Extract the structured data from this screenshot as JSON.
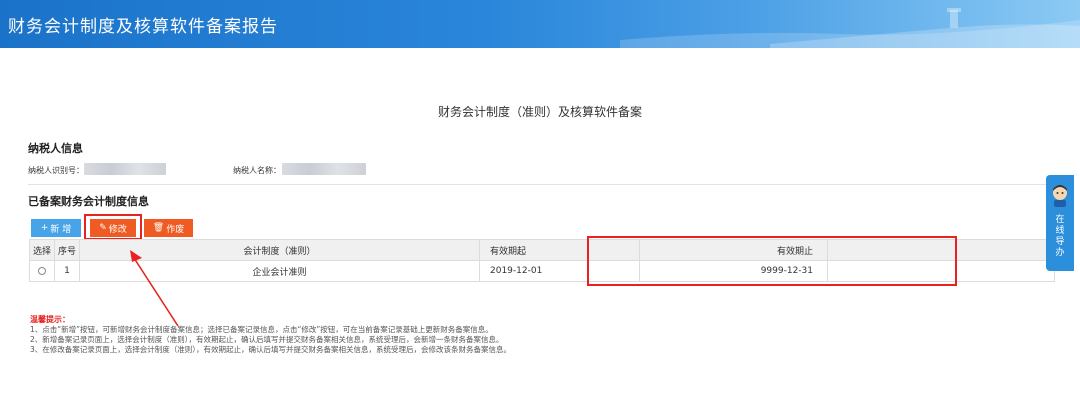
{
  "header": {
    "title": "财务会计制度及核算软件备案报告"
  },
  "page": {
    "title": "财务会计制度（准则）及核算软件备案"
  },
  "taxpayer": {
    "section_title": "纳税人信息",
    "id_label": "纳税人识别号：",
    "name_label": "纳税人名称："
  },
  "filed": {
    "section_title": "已备案财务会计制度信息",
    "buttons": {
      "add": "新 增",
      "edit": "修改",
      "void": "作废"
    },
    "columns": [
      "选择",
      "序号",
      "会计制度（准则）",
      "有效期起",
      "有效期止"
    ],
    "rows": [
      {
        "no": "1",
        "rule": "企业会计准则",
        "start": "2019-12-01",
        "end": "9999-12-31"
      }
    ]
  },
  "tips": {
    "title": "温馨提示：",
    "lines": [
      "1、点击“新增”按钮，可新增财务会计制度备案信息；选择已备案记录信息，点击“修改”按钮，可在当前备案记录基础上更新财务备案信息。",
      "2、新增备案记录页面上，选择会计制度（准则），有效期起止，确认后填写并提交财务备案相关信息，系统受理后，会新增一条财务备案信息。",
      "3、在修改备案记录页面上，选择会计制度（准则），有效期起止，确认后填写并提交财务备案相关信息，系统受理后，会修改该条财务备案信息。"
    ]
  },
  "float_guide": {
    "label": "在线导办"
  },
  "colors": {
    "header": "#1a73c9",
    "accent": "#ef5b22",
    "primary": "#48a4e8",
    "highlight": "#e8231f"
  },
  "icons": {
    "add": "plus-icon",
    "edit": "pencil-icon",
    "void": "trash-icon"
  }
}
